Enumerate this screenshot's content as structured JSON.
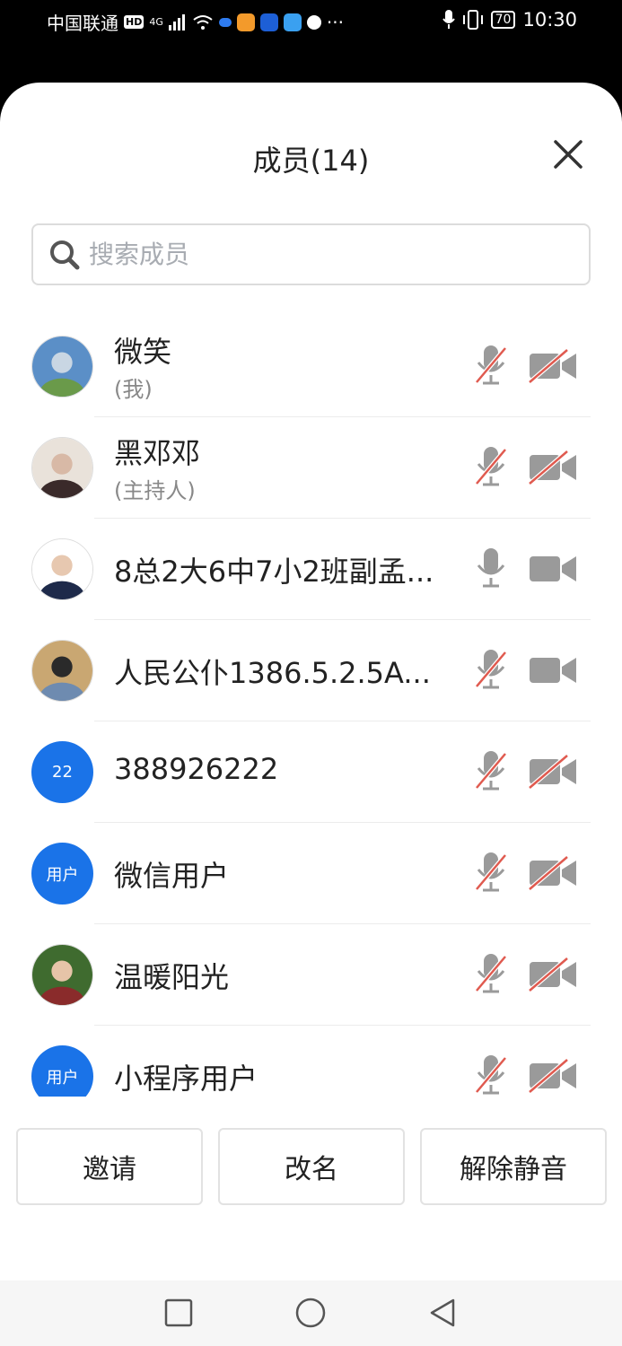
{
  "status_bar": {
    "carrier": "中国联通",
    "hd": "HD",
    "network": "4G",
    "battery": "70",
    "time": "10:30",
    "more": "···"
  },
  "header": {
    "title": "成员(14)"
  },
  "search": {
    "placeholder": "搜索成员"
  },
  "members": [
    {
      "name": "微笑",
      "role": "(我)",
      "avatar_text": "",
      "mic_muted": true,
      "cam_off": true
    },
    {
      "name": "黑邓邓",
      "role": "(主持人)",
      "avatar_text": "",
      "mic_muted": true,
      "cam_off": true
    },
    {
      "name": "8总2大6中7小2班副孟...",
      "role": "",
      "avatar_text": "",
      "mic_muted": false,
      "cam_off": false
    },
    {
      "name": "人民公仆1386.5.2.5A...",
      "role": "",
      "avatar_text": "",
      "mic_muted": true,
      "cam_off": false
    },
    {
      "name": "388926222",
      "role": "",
      "avatar_text": "22",
      "mic_muted": true,
      "cam_off": true
    },
    {
      "name": "微信用户",
      "role": "",
      "avatar_text": "用户",
      "mic_muted": true,
      "cam_off": true
    },
    {
      "name": "温暖阳光",
      "role": "",
      "avatar_text": "",
      "mic_muted": true,
      "cam_off": true
    },
    {
      "name": "小程序用户",
      "role": "",
      "avatar_text": "用户",
      "mic_muted": true,
      "cam_off": true
    }
  ],
  "actions": {
    "invite": "邀请",
    "rename": "改名",
    "unmute": "解除静音"
  },
  "colors": {
    "accent": "#1a73e8",
    "muted_slash": "#e05a4f",
    "icon_gray": "#9a9a9a"
  }
}
